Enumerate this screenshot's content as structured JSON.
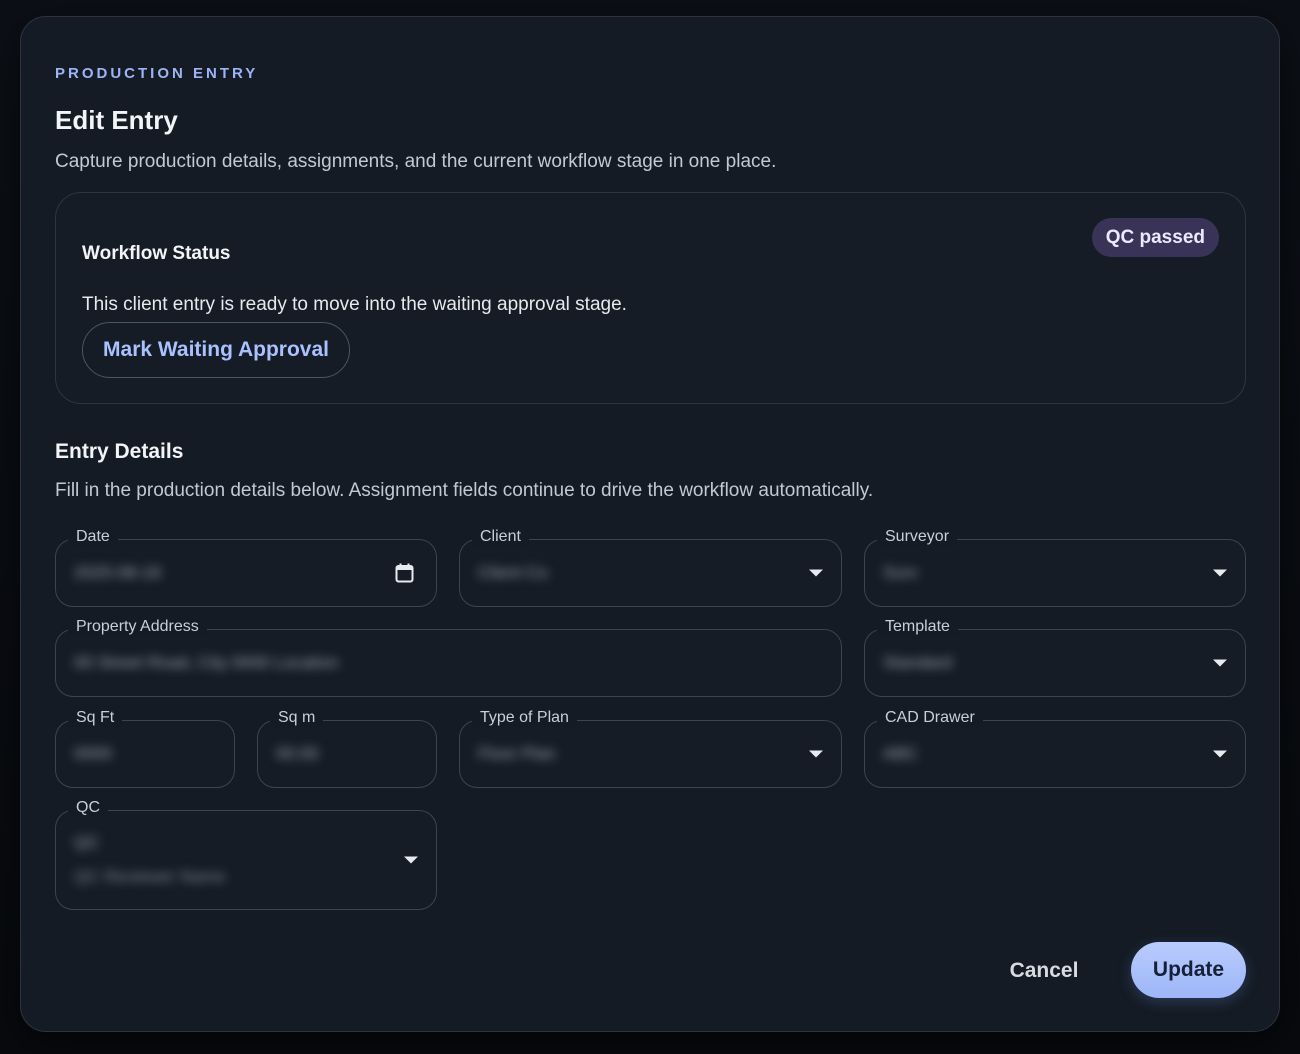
{
  "dialog": {
    "eyebrow": "PRODUCTION ENTRY",
    "title": "Edit Entry",
    "subtitle": "Capture production details, assignments, and the current workflow stage in one place."
  },
  "workflow": {
    "title": "Workflow Status",
    "badge": "QC passed",
    "message": "This client entry is ready to move into the waiting approval stage.",
    "action_label": "Mark Waiting Approval"
  },
  "details": {
    "title": "Entry Details",
    "subtitle": "Fill in the production details below. Assignment fields continue to drive the workflow automatically."
  },
  "fields": {
    "date": {
      "label": "Date",
      "value": "2025-08-18"
    },
    "client": {
      "label": "Client",
      "value": "Client Co"
    },
    "surveyor": {
      "label": "Surveyor",
      "value": "Surv"
    },
    "address": {
      "label": "Property Address",
      "value": "00 Street Road, City 0000 Location"
    },
    "template": {
      "label": "Template",
      "value": "Standard"
    },
    "sqft": {
      "label": "Sq Ft",
      "value": "0000"
    },
    "sqm": {
      "label": "Sq m",
      "value": "00.00"
    },
    "plan": {
      "label": "Type of Plan",
      "value": "Floor Plan"
    },
    "cad": {
      "label": "CAD Drawer",
      "value": "ABC"
    },
    "qc": {
      "label": "QC",
      "value": "QC",
      "sub": "QC Reviewer Name"
    }
  },
  "footer": {
    "cancel_label": "Cancel",
    "update_label": "Update"
  },
  "colors": {
    "accent": "#a9c1ff",
    "badge_bg": "#3a3358",
    "dialog_bg": "#141b24"
  }
}
